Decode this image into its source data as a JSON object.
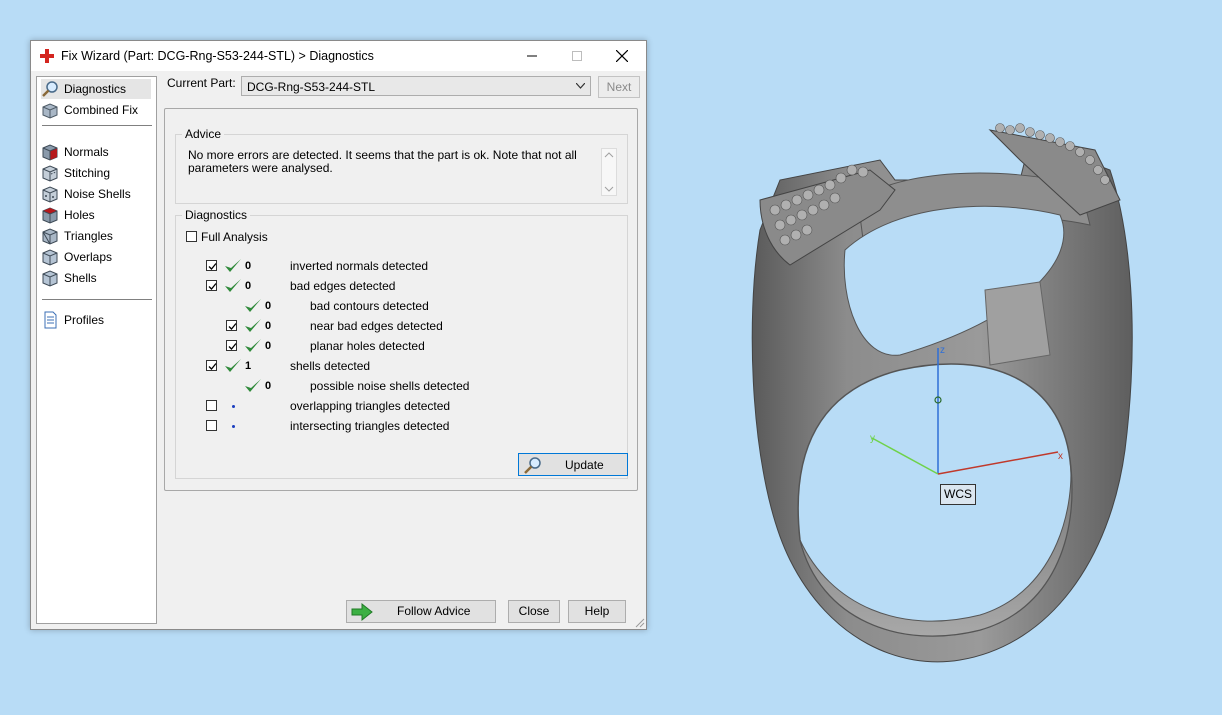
{
  "window": {
    "title": "Fix Wizard (Part: DCG-Rng-S53-244-STL) > Diagnostics"
  },
  "nav": {
    "items": [
      {
        "label": "Diagnostics",
        "icon": "magnifier-icon",
        "selected": true
      },
      {
        "label": "Combined Fix",
        "icon": "combined-fix-icon"
      },
      {
        "label": "Normals",
        "icon": "normals-cube-icon"
      },
      {
        "label": "Stitching",
        "icon": "stitching-cube-icon"
      },
      {
        "label": "Noise Shells",
        "icon": "noise-shells-cube-icon"
      },
      {
        "label": "Holes",
        "icon": "holes-cube-icon"
      },
      {
        "label": "Triangles",
        "icon": "triangles-cube-icon"
      },
      {
        "label": "Overlaps",
        "icon": "overlaps-cube-icon"
      },
      {
        "label": "Shells",
        "icon": "shells-cube-icon"
      },
      {
        "label": "Profiles",
        "icon": "profiles-document-icon"
      }
    ]
  },
  "current_part": {
    "label": "Current Part:",
    "value": "DCG-Rng-S53-244-STL",
    "next_label": "Next"
  },
  "advice": {
    "title": "Advice",
    "text": "No more errors are detected. It seems that the part is ok. Note that not all parameters were analysed."
  },
  "diagnostics": {
    "title": "Diagnostics",
    "full_analysis_label": "Full Analysis",
    "rows": [
      {
        "count": "0",
        "label": "inverted normals detected",
        "checked": true,
        "status": "ok"
      },
      {
        "count": "0",
        "label": "bad edges detected",
        "checked": true,
        "status": "ok"
      },
      {
        "count": "0",
        "label": "bad contours detected",
        "checked": null,
        "status": "ok"
      },
      {
        "count": "0",
        "label": "near bad edges detected",
        "checked": true,
        "status": "ok"
      },
      {
        "count": "0",
        "label": "planar holes detected",
        "checked": true,
        "status": "ok"
      },
      {
        "count": "1",
        "label": "shells detected",
        "checked": true,
        "status": "ok"
      },
      {
        "count": "0",
        "label": "possible noise shells detected",
        "checked": null,
        "status": "ok"
      },
      {
        "count": "",
        "label": "overlapping triangles detected",
        "checked": false,
        "status": "not-analysed"
      },
      {
        "count": "",
        "label": "intersecting triangles detected",
        "checked": false,
        "status": "not-analysed"
      }
    ],
    "update_label": "Update"
  },
  "footer": {
    "follow_advice_label": "Follow Advice",
    "close_label": "Close",
    "help_label": "Help"
  },
  "viewport": {
    "wcs_label": "WCS",
    "axis_x": "x",
    "axis_y": "y",
    "axis_z": "z",
    "colors": {
      "background": "#b8dcf6",
      "x_axis": "#c0392b",
      "y_axis": "#6fd24a",
      "z_axis": "#2f6fd6",
      "ring": "#7d7d7d"
    }
  }
}
